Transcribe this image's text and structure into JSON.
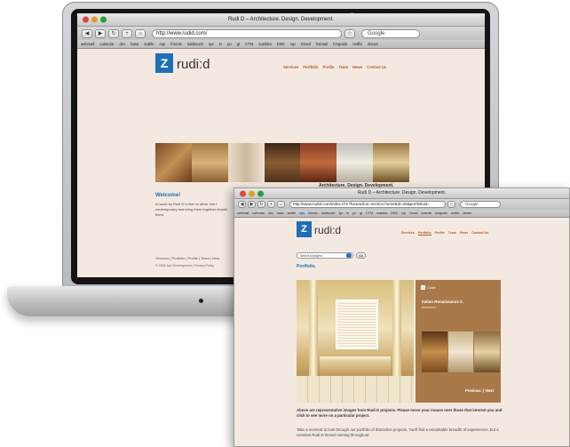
{
  "window_title": "Rudi D – Architecture. Design. Development.",
  "url": "http://www.rudid.com/",
  "url_portfolio": "http://www.rudid.com/index.cfm?fuseaction=section.home&id=26&portfolioid=",
  "search_placeholder": "Google",
  "bookmarks": [
    "webmail",
    "calendar",
    "dev",
    "base",
    "subtle",
    "mju",
    "friends",
    "habbouch",
    "tye",
    "tx",
    "po",
    "gt",
    "CTM",
    "sushiba",
    "EMC",
    "iop",
    "Gmail",
    "hotmail",
    "hmguide",
    "netflix",
    "dream"
  ],
  "logo": {
    "mark": "Z",
    "text": "rudi:d"
  },
  "nav": [
    "Services",
    "Portfolio",
    "Profile",
    "Team",
    "News",
    "Contact Us"
  ],
  "laptop_page": {
    "tagline": "Architecture. Design. Development.",
    "welcome_heading": "Welcome!",
    "welcome_body": "A home by Rudi D is like no other. We t contemporary and bring them together inhabit them.",
    "footer_links": "Services | Portfolio | Profile | Team | New",
    "copyright": "© 2005 Ace Development | Privacy Policy"
  },
  "portfolio_page": {
    "select_placeholder": "Select a project",
    "go_label": "Go",
    "heading": "Portfolio.",
    "close_label": "Close",
    "project_title": "Italian Renaissance 2.",
    "project_subtitle": "Bathroom",
    "previous_label": "Previous",
    "next_label": "Next",
    "intro_bold": "Above are representative images from Rudi D projects. Please move your mouse over those that interest you and click to see more on a particular project.",
    "intro_body": "Take a moment to look through our portfolio of distinctive projects. You'll find a remarkable breadth of experiences, but a constant Rudi D thread running throughout."
  },
  "colors": {
    "accent": "#b35a2a",
    "brand_blue": "#1f6fb8",
    "page_bg": "#f3e9e1",
    "panel_brown": "#a9794a"
  }
}
